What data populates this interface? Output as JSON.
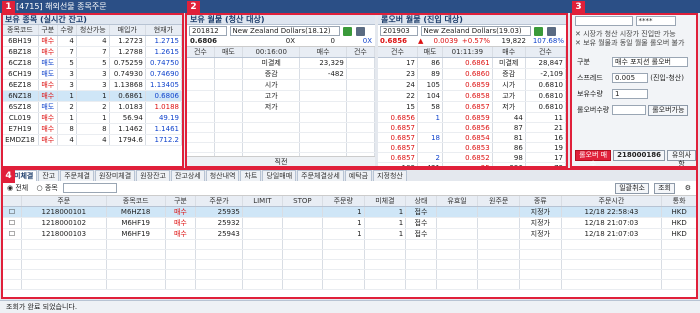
{
  "window_title": "[4715] 해외선물 종목주문",
  "badges": [
    "1",
    "2",
    "3",
    "4"
  ],
  "p1": {
    "title": "보유 종목 (실시간 잔고)",
    "headers": [
      "종목코드",
      "구분",
      "수량",
      "청산가능",
      "매입가",
      "현재가"
    ],
    "rows": [
      [
        "6BH19",
        "매수",
        "4",
        "4",
        "1.2723",
        "1.2715"
      ],
      [
        "6BZ18",
        "매수",
        "7",
        "7",
        "1.2788",
        "1.2615"
      ],
      [
        "6CZ18",
        "매도",
        "5",
        "5",
        "0.75259",
        "0.74750"
      ],
      [
        "6CH19",
        "매도",
        "3",
        "3",
        "0.74930",
        "0.74690"
      ],
      [
        "6EZ18",
        "매수",
        "3",
        "3",
        "1.13868",
        "1.13405"
      ],
      [
        "6NZ18",
        "매수",
        "1",
        "1",
        "0.6861",
        "0.6806"
      ],
      [
        "6SZ18",
        "매도",
        "2",
        "2",
        "1.0183",
        "1.0188"
      ],
      [
        "CL019",
        "매수",
        "1",
        "1",
        "56.94",
        "49.19"
      ],
      [
        "E7H19",
        "매수",
        "8",
        "8",
        "1.1462",
        "1.1461"
      ],
      [
        "EMDZ18",
        "매수",
        "4",
        "4",
        "1794.6",
        "1712.2"
      ]
    ]
  },
  "p2": {
    "title": "보유 월물 (청산 대상)",
    "code": "201812",
    "name": "New Zealand Dollars(18.12)",
    "price": "0.6806",
    "ox": "0X",
    "zero": "0",
    "side": "0X",
    "hdr": [
      "건수",
      "매도",
      "00:16:00",
      "매수",
      "건수"
    ],
    "labels": [
      "미결제",
      "증감",
      "시가",
      "고가",
      "저가"
    ],
    "vals": [
      "23,329",
      "-482",
      "",
      "",
      ""
    ],
    "foot": "직전"
  },
  "p2b": {
    "title": "롤오버 월물 (진입 대상)",
    "code": "201903",
    "name": "New Zealand Dollars(19.03)",
    "price": "0.6856",
    "chg": "0.0039",
    "pct": "+0.57%",
    "vol": "19,822",
    "last": "107.68%",
    "hdr": [
      "건수",
      "매도",
      "01:11:39",
      "매수",
      "건수"
    ],
    "asks": [
      [
        "17",
        "86",
        "0.6861"
      ],
      [
        "23",
        "89",
        "0.6860"
      ],
      [
        "24",
        "105",
        "0.6859"
      ],
      [
        "22",
        "104",
        "0.6858"
      ],
      [
        "15",
        "58",
        "0.6857"
      ]
    ],
    "labels": [
      "미결제",
      "증감",
      "시가",
      "고가",
      "저가"
    ],
    "vals": [
      "28,847",
      "-2,109",
      "0.6810",
      "0.6810",
      "0.6810"
    ],
    "bids": [
      [
        "0.6856",
        "1",
        "0.6859",
        "44",
        "11"
      ],
      [
        "0.6857",
        "",
        "0.6856",
        "87",
        "21"
      ],
      [
        "0.6857",
        "18",
        "0.6854",
        "81",
        "16"
      ],
      [
        "0.6857",
        "",
        "0.6853",
        "86",
        "19"
      ],
      [
        "0.6857",
        "2",
        "0.6852",
        "98",
        "17"
      ]
    ],
    "foot": [
      "103",
      "421",
      "-25",
      "396",
      "73"
    ],
    "foot_label": "직전"
  },
  "p3": {
    "acct": "****",
    "notes": [
      "시장가 청산 시장가 진입만 가능",
      "보유 월물과 동일 월물 롤오버 불가"
    ],
    "fields": [
      {
        "label": "구분",
        "value": "매수 포지션 롤오버"
      },
      {
        "label": "스프레드",
        "value": "0.005",
        "extra": "(진입-청산)"
      },
      {
        "label": "보유수량",
        "value": "1"
      },
      {
        "label": "롤오버수량",
        "value": "",
        "btn": "롤오버가능"
      }
    ],
    "order_btn": "롤오버 매수",
    "order_no": "218000186",
    "warn_btn": "유의사항"
  },
  "p4": {
    "tabs": [
      "미체결",
      "잔고",
      "주문체결",
      "원장미체결",
      "원장잔고",
      "잔고상세",
      "청산내역",
      "차트",
      "당일매매",
      "주문체결상세",
      "예탁금",
      "지정청산"
    ],
    "radio_all": "전체",
    "radio_code": "종목",
    "cancel_btn": "일괄취소",
    "query_btn": "조회",
    "headers": [
      "주문",
      "종목코드",
      "구분",
      "주문가",
      "LIMIT",
      "STOP",
      "주문량",
      "미체결",
      "상태",
      "유효일",
      "원주문",
      "종류",
      "주문시간",
      "통화"
    ],
    "rows": [
      [
        "1218000101",
        "M6HZ18",
        "매수",
        "25935",
        "",
        "",
        "1",
        "1",
        "접수",
        "",
        "",
        "지정가",
        "12/18 22:58:43",
        "HKD"
      ],
      [
        "1218000102",
        "M6HF19",
        "매수",
        "25932",
        "",
        "",
        "1",
        "1",
        "접수",
        "",
        "",
        "지정가",
        "12/18 21:07:03",
        "HKD"
      ],
      [
        "1218000103",
        "M6HF19",
        "매수",
        "25943",
        "",
        "",
        "1",
        "1",
        "접수",
        "",
        "",
        "지정가",
        "12/18 21:07:03",
        "HKD"
      ]
    ],
    "status": "조회가 완료 되었습니다."
  }
}
